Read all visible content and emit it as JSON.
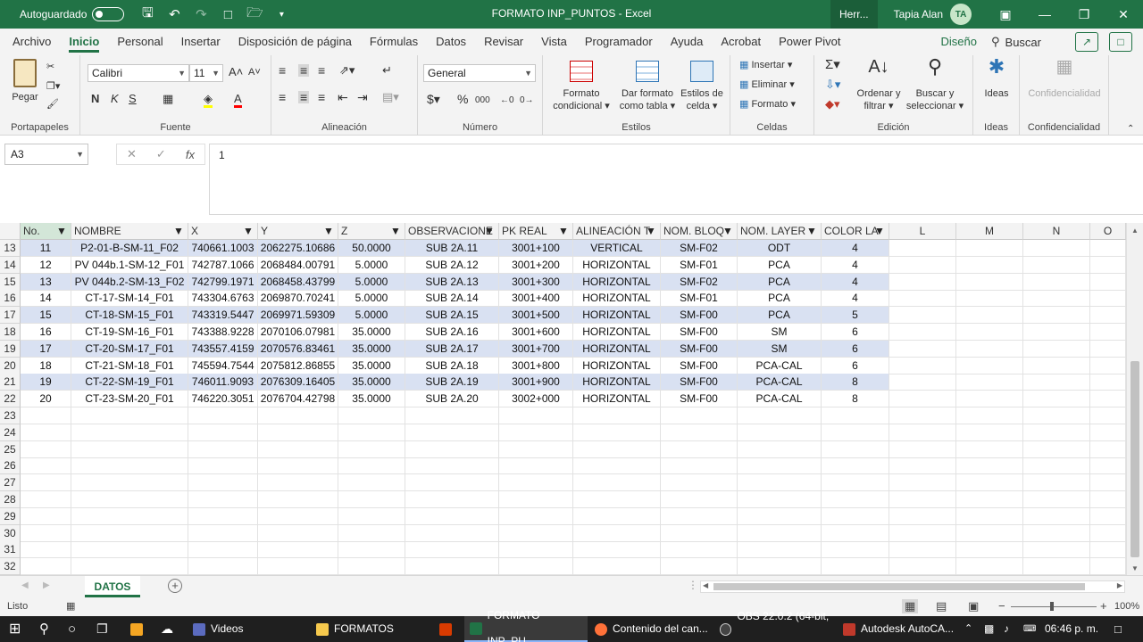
{
  "titlebar": {
    "autosave_label": "Autoguardado",
    "title": "FORMATO INP_PUNTOS  -  Excel",
    "herr": "Herr...",
    "user_name": "Tapia Alan",
    "user_initials": "TA"
  },
  "menu": {
    "tabs": [
      "Archivo",
      "Inicio",
      "Personal",
      "Insertar",
      "Disposición de página",
      "Fórmulas",
      "Datos",
      "Revisar",
      "Vista",
      "Programador",
      "Ayuda",
      "Acrobat",
      "Power Pivot",
      "Diseño"
    ],
    "active_index": 1,
    "search_label": "Buscar"
  },
  "ribbon": {
    "clipboard": {
      "label": "Portapapeles",
      "paste": "Pegar"
    },
    "font": {
      "label": "Fuente",
      "name": "Calibri",
      "size": "11"
    },
    "alignment": {
      "label": "Alineación"
    },
    "number": {
      "label": "Número",
      "format": "General"
    },
    "styles": {
      "label": "Estilos",
      "conditional": [
        "Formato",
        "condicional"
      ],
      "table": [
        "Dar formato",
        "como tabla"
      ],
      "cell": [
        "Estilos de",
        "celda"
      ]
    },
    "cells": {
      "label": "Celdas",
      "insert": "Insertar",
      "delete": "Eliminar",
      "format": "Formato"
    },
    "editing": {
      "label": "Edición",
      "sort": [
        "Ordenar y",
        "filtrar"
      ],
      "find": [
        "Buscar y",
        "seleccionar"
      ]
    },
    "ideas": {
      "label": "Ideas",
      "button": "Ideas"
    },
    "sensitivity": {
      "label": "Confidencialidad",
      "button": "Confidencialidad"
    }
  },
  "formula_bar": {
    "name_box": "A3",
    "value": "1"
  },
  "grid": {
    "columns": [
      "No.",
      "NOMBRE",
      "X",
      "Y",
      "Z",
      "OBSERVACIONE",
      "PK REAL",
      "ALINEACIÓN T",
      "NOM. BLOQ",
      "NOM. LAYER",
      "COLOR LA",
      "L",
      "M",
      "N",
      "O"
    ],
    "rows": [
      {
        "num": "13",
        "cells": [
          "11",
          "P2-01-B-SM-11_F02",
          "740661.1003",
          "2062275.10686",
          "50.0000",
          "SUB 2A.11",
          "3001+100",
          "VERTICAL",
          "SM-F02",
          "ODT",
          "4"
        ]
      },
      {
        "num": "14",
        "cells": [
          "12",
          "PV 044b.1-SM-12_F01",
          "742787.1066",
          "2068484.00791",
          "5.0000",
          "SUB 2A.12",
          "3001+200",
          "HORIZONTAL",
          "SM-F01",
          "PCA",
          "4"
        ]
      },
      {
        "num": "15",
        "cells": [
          "13",
          "PV 044b.2-SM-13_F02",
          "742799.1971",
          "2068458.43799",
          "5.0000",
          "SUB 2A.13",
          "3001+300",
          "HORIZONTAL",
          "SM-F02",
          "PCA",
          "4"
        ]
      },
      {
        "num": "16",
        "cells": [
          "14",
          "CT-17-SM-14_F01",
          "743304.6763",
          "2069870.70241",
          "5.0000",
          "SUB 2A.14",
          "3001+400",
          "HORIZONTAL",
          "SM-F01",
          "PCA",
          "4"
        ]
      },
      {
        "num": "17",
        "cells": [
          "15",
          "CT-18-SM-15_F01",
          "743319.5447",
          "2069971.59309",
          "5.0000",
          "SUB 2A.15",
          "3001+500",
          "HORIZONTAL",
          "SM-F00",
          "PCA",
          "5"
        ]
      },
      {
        "num": "18",
        "cells": [
          "16",
          "CT-19-SM-16_F01",
          "743388.9228",
          "2070106.07981",
          "35.0000",
          "SUB 2A.16",
          "3001+600",
          "HORIZONTAL",
          "SM-F00",
          "SM",
          "6"
        ]
      },
      {
        "num": "19",
        "cells": [
          "17",
          "CT-20-SM-17_F01",
          "743557.4159",
          "2070576.83461",
          "35.0000",
          "SUB 2A.17",
          "3001+700",
          "HORIZONTAL",
          "SM-F00",
          "SM",
          "6"
        ]
      },
      {
        "num": "20",
        "cells": [
          "18",
          "CT-21-SM-18_F01",
          "745594.7544",
          "2075812.86855",
          "35.0000",
          "SUB 2A.18",
          "3001+800",
          "HORIZONTAL",
          "SM-F00",
          "PCA-CAL",
          "6"
        ]
      },
      {
        "num": "21",
        "cells": [
          "19",
          "CT-22-SM-19_F01",
          "746011.9093",
          "2076309.16405",
          "35.0000",
          "SUB 2A.19",
          "3001+900",
          "HORIZONTAL",
          "SM-F00",
          "PCA-CAL",
          "8"
        ]
      },
      {
        "num": "22",
        "cells": [
          "20",
          "CT-23-SM-20_F01",
          "746220.3051",
          "2076704.42798",
          "35.0000",
          "SUB 2A.20",
          "3002+000",
          "HORIZONTAL",
          "SM-F00",
          "PCA-CAL",
          "8"
        ]
      }
    ],
    "empty_rows": [
      "23",
      "24",
      "25",
      "26",
      "27",
      "28",
      "29",
      "30",
      "31",
      "32"
    ]
  },
  "sheets": {
    "active": "DATOS"
  },
  "status": {
    "mode": "Listo",
    "zoom": "100%"
  },
  "taskbar": {
    "items": [
      "Videos",
      "FORMATOS",
      "FORMATO INP_PU...",
      "Contenido del can...",
      "OBS 22.0.2 (64-bit, ...",
      "Autodesk AutoCA..."
    ],
    "time": "06:46 p. m."
  },
  "colors": {
    "accent": "#217346",
    "band": "#d9e1f2",
    "taskbar": "#1f1f1f"
  }
}
